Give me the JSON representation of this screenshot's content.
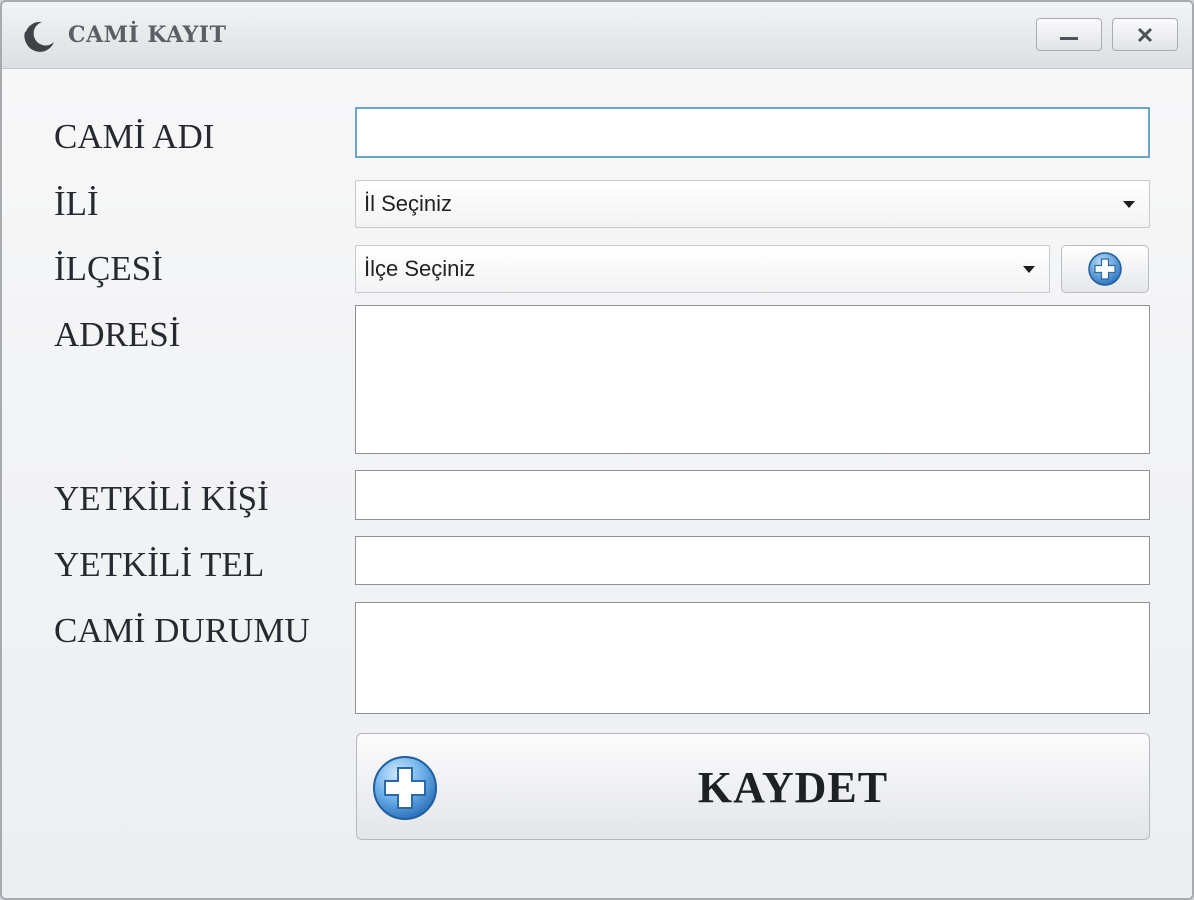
{
  "window": {
    "title": "CAMİ KAYIT",
    "minimize_glyph": "—",
    "close_glyph": "✕"
  },
  "form": {
    "labels": {
      "cami_adi": "CAMİ ADI",
      "ili": "İLİ",
      "ilcesi": "İLÇESİ",
      "adresi": "ADRESİ",
      "yetkili_kisi": "YETKİLİ KİŞİ",
      "yetkili_tel": "YETKİLİ TEL",
      "cami_durumu": "CAMİ DURUMU"
    },
    "values": {
      "cami_adi": "",
      "adresi": "",
      "yetkili_kisi": "",
      "yetkili_tel": "",
      "cami_durumu": ""
    },
    "il_select": {
      "selected": "İl Seçiniz"
    },
    "ilce_select": {
      "selected": "İlçe Seçiniz"
    },
    "save_button": {
      "label": "KAYDET"
    }
  },
  "icons": {
    "app": "crescent-moon-icon",
    "add": "plus-circle-icon"
  },
  "colors": {
    "focus_border": "#6aa4c8",
    "icon_blue": "#3d86c9"
  }
}
